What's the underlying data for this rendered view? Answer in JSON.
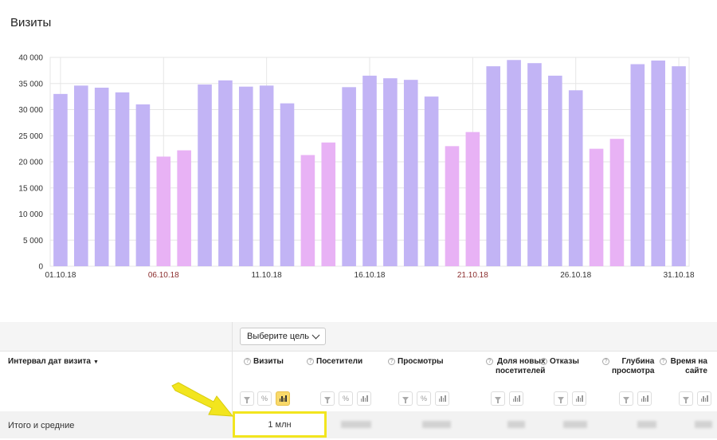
{
  "page": {
    "title": "Визиты"
  },
  "chart_data": {
    "type": "bar",
    "title": "",
    "ylim": [
      0,
      40000
    ],
    "yticks": [
      "0",
      "5 000",
      "10 000",
      "15 000",
      "20 000",
      "25 000",
      "30 000",
      "35 000",
      "40 000"
    ],
    "x_labels": [
      {
        "index": 0,
        "text": "01.10.18",
        "weekend": false
      },
      {
        "index": 5,
        "text": "06.10.18",
        "weekend": true
      },
      {
        "index": 10,
        "text": "11.10.18",
        "weekend": false
      },
      {
        "index": 15,
        "text": "16.10.18",
        "weekend": false
      },
      {
        "index": 20,
        "text": "21.10.18",
        "weekend": true
      },
      {
        "index": 25,
        "text": "26.10.18",
        "weekend": false
      },
      {
        "index": 30,
        "text": "31.10.18",
        "weekend": false
      }
    ],
    "categories": [
      "01.10.18",
      "02.10.18",
      "03.10.18",
      "04.10.18",
      "05.10.18",
      "06.10.18",
      "07.10.18",
      "08.10.18",
      "09.10.18",
      "10.10.18",
      "11.10.18",
      "12.10.18",
      "13.10.18",
      "14.10.18",
      "15.10.18",
      "16.10.18",
      "17.10.18",
      "18.10.18",
      "19.10.18",
      "20.10.18",
      "21.10.18",
      "22.10.18",
      "23.10.18",
      "24.10.18",
      "25.10.18",
      "26.10.18",
      "27.10.18",
      "28.10.18",
      "29.10.18",
      "30.10.18",
      "31.10.18"
    ],
    "values": [
      33000,
      34600,
      34200,
      33300,
      31000,
      21000,
      22200,
      34800,
      35600,
      34400,
      34600,
      31200,
      21300,
      23700,
      34300,
      36500,
      36000,
      35700,
      32500,
      23000,
      25700,
      38300,
      39500,
      38900,
      36500,
      33700,
      22500,
      24400,
      38700,
      39400,
      38300
    ],
    "weekend": [
      false,
      false,
      false,
      false,
      false,
      true,
      true,
      false,
      false,
      false,
      false,
      false,
      true,
      true,
      false,
      false,
      false,
      false,
      false,
      true,
      true,
      false,
      false,
      false,
      false,
      false,
      true,
      true,
      false,
      false,
      false
    ],
    "colors": {
      "weekday": "#c2b4f5",
      "weekend": "#e8b2f5",
      "grid": "#e6e6e6",
      "weekend_label": "#8b2d2d"
    }
  },
  "toolbar": {
    "goal_button": "Выберите цель"
  },
  "table": {
    "dimension_header": "Интервал дат визита",
    "sort_indicator": "▼",
    "columns": [
      {
        "label": "Визиты"
      },
      {
        "label": "Посетители"
      },
      {
        "label": "Просмотры"
      },
      {
        "label": "Доля новых посетителей"
      },
      {
        "label": "Отказы"
      },
      {
        "label": "Глубина просмотра"
      },
      {
        "label": "Время на сайте"
      }
    ],
    "percent_symbol": "%",
    "total_row": {
      "label": "Итого и средние",
      "visits": "1 млн"
    }
  },
  "annotation": {
    "arrow_color": "#f2e51e",
    "highlight_color": "#f2e51e"
  }
}
